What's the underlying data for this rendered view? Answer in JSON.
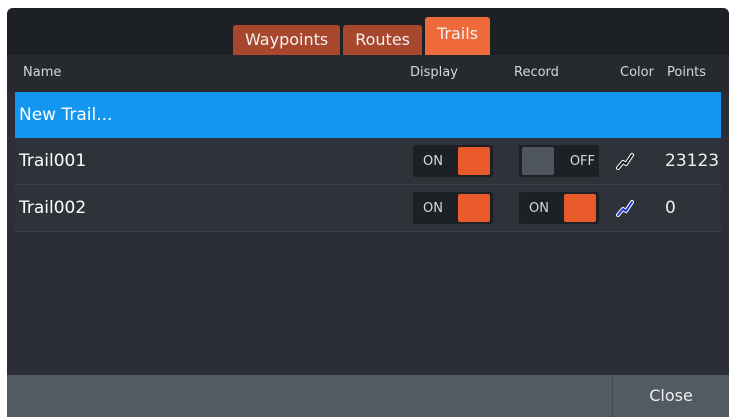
{
  "tabs": [
    {
      "label": "Waypoints"
    },
    {
      "label": "Routes"
    },
    {
      "label": "Trails"
    }
  ],
  "active_tab": "Trails",
  "columns": {
    "name": "Name",
    "display": "Display",
    "record": "Record",
    "color": "Color",
    "points": "Points"
  },
  "new_trail_label": "New Trail...",
  "trails": [
    {
      "name": "Trail001",
      "display": {
        "state": "ON"
      },
      "record": {
        "state": "OFF"
      },
      "color_icon": "trail-color-icon",
      "color": "#111111",
      "points": "23123"
    },
    {
      "name": "Trail002",
      "display": {
        "state": "ON"
      },
      "record": {
        "state": "ON"
      },
      "color_icon": "trail-color-icon",
      "color": "#1a3bd6",
      "points": "0"
    }
  ],
  "footer": {
    "close_label": "Close"
  },
  "colors": {
    "accent": "#ef6a3a",
    "selection": "#1296f0",
    "toggle_on": "#e85a2a"
  }
}
